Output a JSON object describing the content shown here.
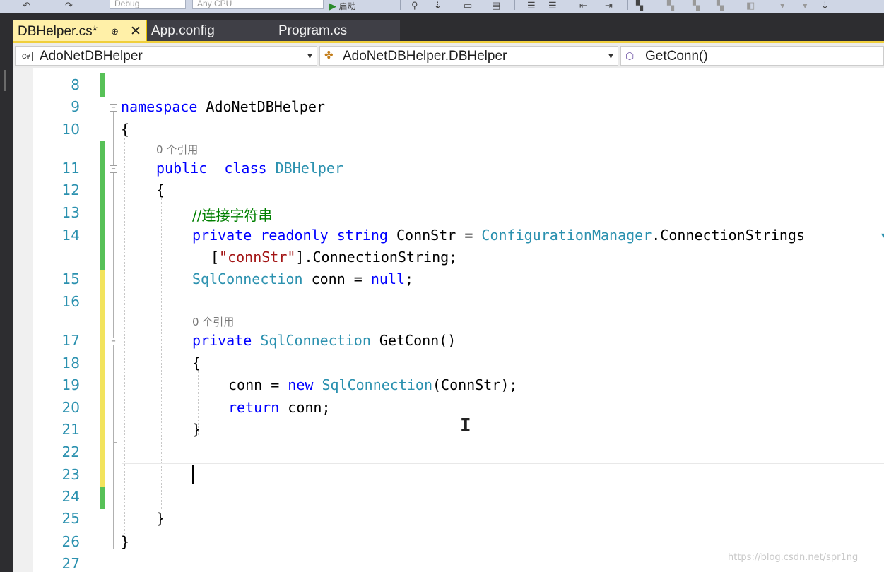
{
  "toolbar": {
    "config_value": "Debug",
    "platform_value": "Any CPU",
    "start_label": "启动"
  },
  "tabs": [
    {
      "label": "DBHelper.cs*",
      "pin": "⊕",
      "close": "✕",
      "active": true
    },
    {
      "label": "App.config",
      "active": false
    },
    {
      "label": "Program.cs",
      "active": false
    }
  ],
  "navigation": {
    "project": "AdoNetDBHelper",
    "class": "AdoNetDBHelper.DBHelper",
    "member": "GetConn()",
    "project_icon": "csharp-project-icon",
    "class_icon": "class-icon",
    "member_icon": "private-method-icon"
  },
  "editor": {
    "line_numbers": [
      "8",
      "9",
      "10",
      "11",
      "12",
      "13",
      "14",
      "15",
      "16",
      "17",
      "18",
      "19",
      "20",
      "21",
      "22",
      "23",
      "24",
      "25",
      "26",
      "27"
    ],
    "ref_class": "0 个引用",
    "ref_method": "0 个引用",
    "code": {
      "l9_kw": "namespace",
      "l9_name": " AdoNetDBHelper",
      "l10": "{",
      "l11_kw1": "public",
      "l11_kw2": "class",
      "l11_name": "DBHelper",
      "l12": "{",
      "l13": "//连接字符串",
      "l14_kw1": "private",
      "l14_kw2": "readonly",
      "l14_kw3": "string",
      "l14_rest": " ConnStr = ",
      "l14_type": "ConfigurationManager",
      "l14_tail": ".ConnectionStrings",
      "l14b_open": "[",
      "l14b_str": "\"connStr\"",
      "l14b_tail": "].ConnectionString;",
      "l15_type": "SqlConnection",
      "l15_rest": " conn = ",
      "l15_kw": "null",
      "l15_end": ";",
      "l17_kw": "private",
      "l17_type": "SqlConnection",
      "l17_rest": " GetConn()",
      "l18": "{",
      "l19_a": "conn = ",
      "l19_kw": "new",
      "l19_type": "SqlConnection",
      "l19_rest": "(ConnStr);",
      "l20_kw": "return",
      "l20_rest": " conn;",
      "l21": "}",
      "l25": "}",
      "l26": "}"
    },
    "change_colors": {
      "saved": "#57c157",
      "unsaved": "#f2e35c"
    }
  },
  "watermark": "https://blog.csdn.net/spr1ng"
}
